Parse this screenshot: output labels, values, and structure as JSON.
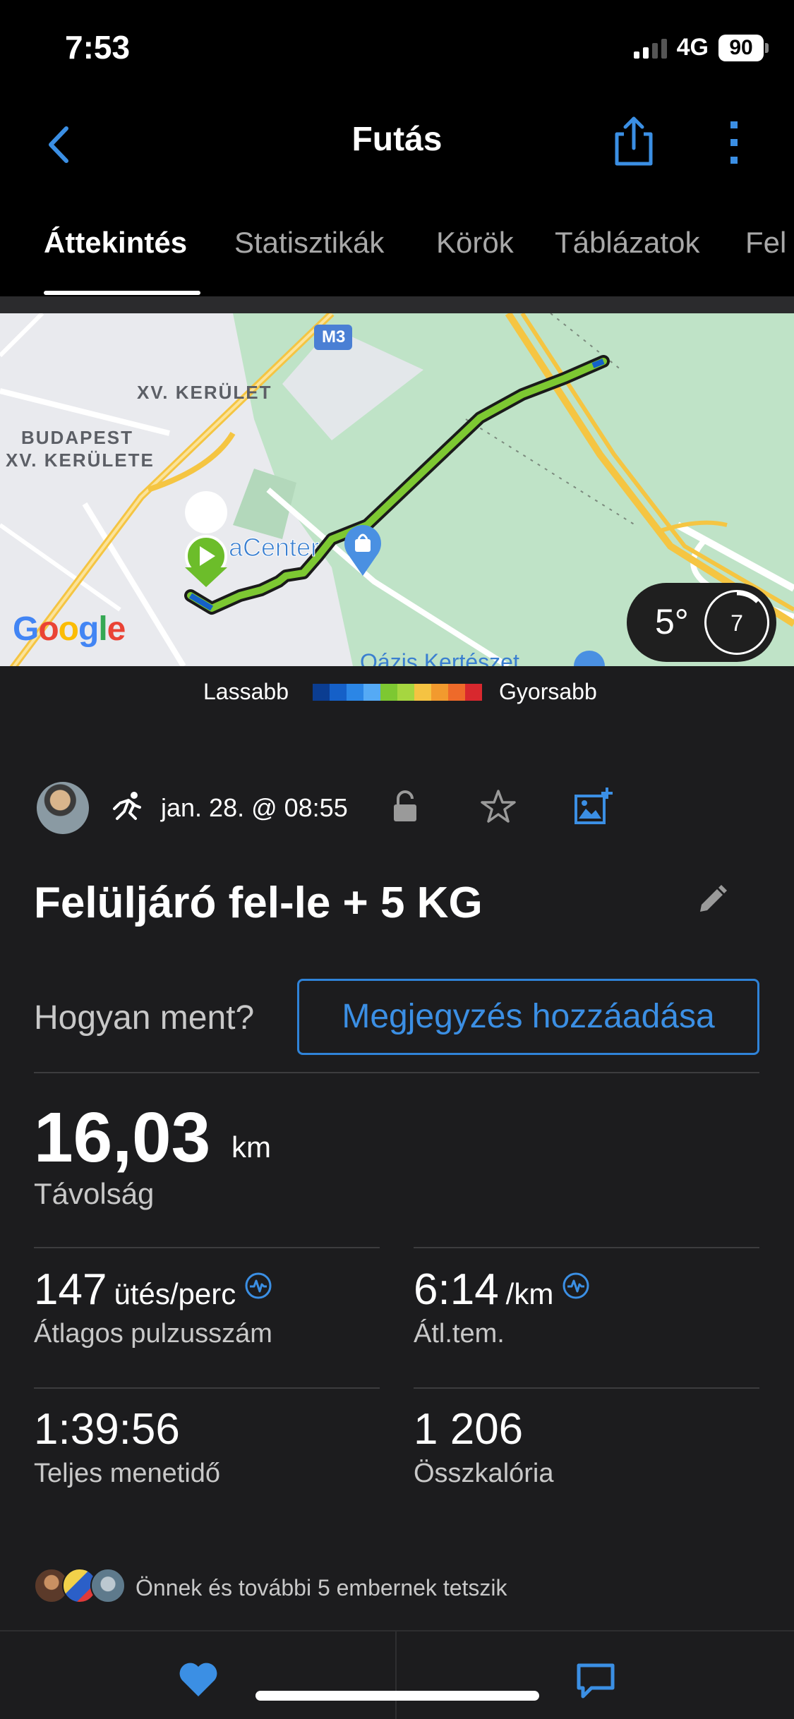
{
  "status_bar": {
    "time": "7:53",
    "network": "4G",
    "battery": "90"
  },
  "nav": {
    "title": "Futás",
    "back_icon": "chevron-left-icon",
    "share_icon": "share-icon",
    "more_icon": "more-vertical-icon"
  },
  "tabs": [
    {
      "label": "Áttekintés",
      "active": true
    },
    {
      "label": "Statisztikák"
    },
    {
      "label": "Körök"
    },
    {
      "label": "Táblázatok"
    },
    {
      "label": "Fel"
    }
  ],
  "map": {
    "labels": {
      "m3": "M3",
      "district": "XV. KERÜLET",
      "budapest_line1": "BUDAPEST",
      "budapest_line2": "XV. KERÜLETE",
      "center": "aCenter",
      "bottom": "Oázis Kertészet",
      "google": "Google"
    },
    "weather": {
      "temperature": "5°",
      "wind": "7"
    }
  },
  "legend": {
    "slow": "Lassabb",
    "fast": "Gyorsabb",
    "colors": [
      "#0b3d91",
      "#1560c8",
      "#2b86e6",
      "#55aaf5",
      "#7dc832",
      "#a6d640",
      "#f5c342",
      "#f29a2e",
      "#ee6a2a",
      "#d8282e"
    ]
  },
  "activity": {
    "date": "jan. 28. @ 08:55",
    "title": "Felüljáró fel-le + 5 KG",
    "note_question": "Hogyan ment?",
    "note_button": "Megjegyzés hozzáadása"
  },
  "stats": {
    "distance": {
      "value": "16,03",
      "unit": "km",
      "label": "Távolság"
    },
    "heart_rate": {
      "value": "147",
      "unit": "ütés/perc",
      "label": "Átlagos pulzusszám"
    },
    "pace": {
      "value": "6:14",
      "unit": "/km",
      "label": "Átl.tem."
    },
    "duration": {
      "value": "1:39:56",
      "label": "Teljes menetidő"
    },
    "calories": {
      "value": "1 206",
      "label": "Összkalória"
    }
  },
  "likes": {
    "text": "Önnek és további 5 embernek tetszik"
  },
  "colors": {
    "accent": "#3b8fe4",
    "background": "#1c1c1e",
    "header": "#000000",
    "route": "#7dc832"
  }
}
